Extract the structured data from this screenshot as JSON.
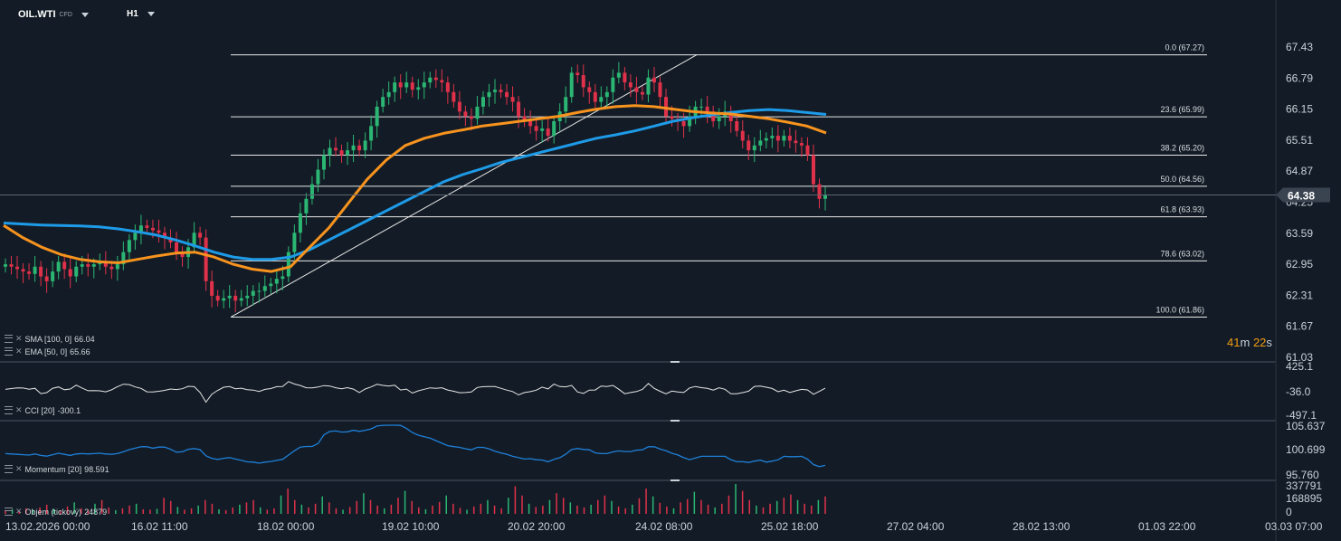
{
  "header": {
    "symbol": "OIL.WTI",
    "instrument_type": "CFD",
    "timeframe": "H1"
  },
  "price_axis": {
    "ticks": [
      "67.43",
      "66.79",
      "66.15",
      "65.51",
      "64.87",
      "64.25",
      "63.59",
      "62.95",
      "62.31",
      "61.67",
      "61.03"
    ],
    "current_price": "64.38",
    "current_price_color": "#3a4450"
  },
  "time_axis": {
    "labels": [
      "13.02.2026  00:00",
      "16.02  11:00",
      "18.02  00:00",
      "19.02  10:00",
      "20.02  20:00",
      "24.02  08:00",
      "25.02  18:00",
      "27.02  04:00",
      "28.02  13:00",
      "01.03  22:00",
      "03.03  07:00"
    ]
  },
  "countdown": {
    "minutes": "41",
    "min_unit": "m",
    "seconds": "22",
    "sec_unit": "s"
  },
  "indicators": {
    "sma": {
      "label": "SMA [100,  0]",
      "value": "66.04",
      "color": "#1e9be8"
    },
    "ema": {
      "label": "EMA [50,  0]",
      "value": "65.66",
      "color": "#f7931e"
    },
    "cci": {
      "label": "CCI [20]",
      "value": "-300.1",
      "ticks": [
        "425.1",
        "-36.0",
        "-497.1"
      ]
    },
    "momentum": {
      "label": "Momentum  [20]",
      "value": "98.591",
      "ticks": [
        "105.637",
        "100.699",
        "95.760"
      ],
      "color": "#1e7fd8"
    },
    "volume": {
      "label": "Objem (tickový)",
      "value": "24879",
      "ticks": [
        "337791",
        "168895",
        "0"
      ]
    }
  },
  "colors": {
    "up": "#2bb673",
    "down": "#e0314a",
    "grid": "#1c2631",
    "fib": "#e8e8e8"
  },
  "chart_data": {
    "type": "candlestick",
    "symbol": "OIL.WTI",
    "interval": "H1",
    "y_range": [
      61.03,
      67.43
    ],
    "fibonacci": [
      {
        "level": "0.0",
        "price": 67.27,
        "label": "0.0 (67.27)"
      },
      {
        "level": "23.6",
        "price": 65.99,
        "label": "23.6 (65.99)"
      },
      {
        "level": "38.2",
        "price": 65.2,
        "label": "38.2 (65.20)"
      },
      {
        "level": "50.0",
        "price": 64.56,
        "label": "50.0 (64.56)"
      },
      {
        "level": "61.8",
        "price": 63.93,
        "label": "61.8 (63.93)"
      },
      {
        "level": "78.6",
        "price": 63.02,
        "label": "78.6 (63.02)"
      },
      {
        "level": "100.0",
        "price": 61.86,
        "label": "100.0 (61.86)"
      }
    ],
    "price_path": [
      62.95,
      62.9,
      62.85,
      62.8,
      62.75,
      62.9,
      62.7,
      62.6,
      62.8,
      63.0,
      62.85,
      62.7,
      62.9,
      62.95,
      62.9,
      62.95,
      63.0,
      62.9,
      62.85,
      62.95,
      63.2,
      63.45,
      63.6,
      63.75,
      63.7,
      63.65,
      63.6,
      63.5,
      63.4,
      63.2,
      63.1,
      63.3,
      63.6,
      63.5,
      62.6,
      62.3,
      62.2,
      62.25,
      62.3,
      62.2,
      62.25,
      62.3,
      62.4,
      62.4,
      62.5,
      62.55,
      62.65,
      62.7,
      63.2,
      63.6,
      64.0,
      64.3,
      64.6,
      64.9,
      65.2,
      65.35,
      65.3,
      65.2,
      65.3,
      65.4,
      65.3,
      65.5,
      65.8,
      66.2,
      66.4,
      66.5,
      66.7,
      66.6,
      66.7,
      66.55,
      66.6,
      66.7,
      66.8,
      66.75,
      66.7,
      66.5,
      66.3,
      66.1,
      66.0,
      65.95,
      66.2,
      66.4,
      66.5,
      66.55,
      66.5,
      66.4,
      66.3,
      66.0,
      65.9,
      65.8,
      65.7,
      65.75,
      65.6,
      65.9,
      66.1,
      66.4,
      66.9,
      66.85,
      66.6,
      66.5,
      66.3,
      66.4,
      66.5,
      66.8,
      66.9,
      66.7,
      66.6,
      66.5,
      66.45,
      66.8,
      66.7,
      66.4,
      66.0,
      65.95,
      65.9,
      65.8,
      66.0,
      66.2,
      66.2,
      66.1,
      65.9,
      66.0,
      66.1,
      65.9,
      65.7,
      65.5,
      65.3,
      65.4,
      65.5,
      65.55,
      65.6,
      65.5,
      65.6,
      65.5,
      65.45,
      65.4,
      65.2,
      64.6,
      64.3,
      64.38
    ],
    "sma_path": [
      63.8,
      63.78,
      63.76,
      63.75,
      63.74,
      63.72,
      63.68,
      63.62,
      63.55,
      63.45,
      63.33,
      63.2,
      63.1,
      63.05,
      63.05,
      63.1,
      63.25,
      63.45,
      63.65,
      63.85,
      64.05,
      64.25,
      64.45,
      64.65,
      64.8,
      64.92,
      65.05,
      65.15,
      65.25,
      65.35,
      65.45,
      65.55,
      65.62,
      65.7,
      65.8,
      65.9,
      65.97,
      66.03,
      66.08,
      66.12,
      66.14,
      66.12,
      66.08,
      66.04
    ],
    "ema_path": [
      63.75,
      63.5,
      63.3,
      63.15,
      63.05,
      63.0,
      62.98,
      63.05,
      63.12,
      63.18,
      63.2,
      63.1,
      62.95,
      62.85,
      62.8,
      62.9,
      63.3,
      63.7,
      64.2,
      64.7,
      65.1,
      65.4,
      65.55,
      65.65,
      65.72,
      65.8,
      65.85,
      65.9,
      65.95,
      66.0,
      66.08,
      66.15,
      66.2,
      66.22,
      66.2,
      66.15,
      66.1,
      66.07,
      66.05,
      66.0,
      65.95,
      65.88,
      65.8,
      65.66
    ],
    "volume_bars": [
      8,
      10,
      6,
      12,
      9,
      14,
      20,
      11,
      7,
      16,
      25,
      12,
      9,
      22,
      30,
      14,
      8,
      12,
      18,
      22,
      10,
      9,
      11,
      35,
      28,
      15,
      9,
      12,
      18,
      30,
      22,
      10,
      8,
      14,
      20,
      25,
      30,
      14,
      9,
      12,
      40,
      55,
      30,
      20,
      14,
      22,
      38,
      25,
      12,
      9,
      15,
      28,
      45,
      30,
      18,
      12,
      20,
      35,
      50,
      28,
      14,
      10,
      18,
      26,
      40,
      22,
      13,
      9,
      16,
      22,
      30,
      18,
      12,
      35,
      60,
      40,
      22,
      15,
      18,
      30,
      45,
      35,
      25,
      18,
      14,
      20,
      30,
      40,
      28,
      16,
      12,
      20,
      34,
      55,
      38,
      24,
      16,
      12,
      25,
      32,
      48,
      30,
      20,
      14,
      22,
      40,
      65,
      50,
      30,
      18,
      14,
      22,
      28,
      35,
      42,
      30,
      22,
      18,
      30,
      38
    ]
  }
}
